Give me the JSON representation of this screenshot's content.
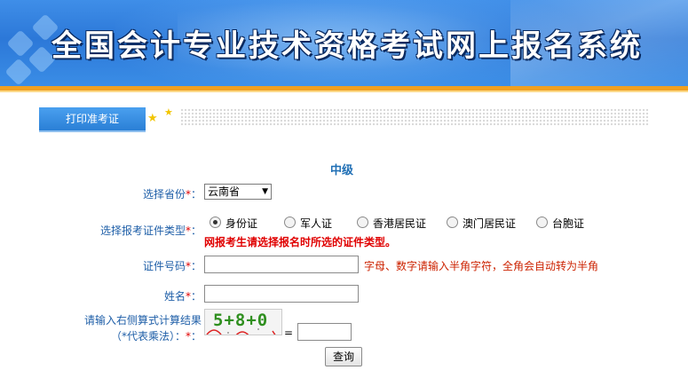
{
  "banner": {
    "title": "全国会计专业技术资格考试网上报名系统"
  },
  "tab": {
    "label": "打印准考证"
  },
  "form": {
    "level": "中级",
    "required_mark": "*",
    "province": {
      "label": "选择省份",
      "value": "云南省"
    },
    "id_type": {
      "label": "选择报考证件类型",
      "options": [
        "身份证",
        "军人证",
        "香港居民证",
        "澳门居民证",
        "台胞证"
      ],
      "selected": "身份证",
      "warning": "网报考生请选择报名时所选的证件类型。"
    },
    "id_number": {
      "label": "证件号码",
      "value": "",
      "hint": "字母、数字请输入半角字符，全角会自动转为半角"
    },
    "name": {
      "label": "姓名",
      "value": ""
    },
    "captcha": {
      "label_line1": "请输入右侧算式计算结果",
      "label_line2": "（*代表乘法）：",
      "expression": "5+8+0",
      "equals": "=",
      "value": ""
    },
    "submit_label": "查询"
  },
  "colors": {
    "banner_blue": "#2c78d8",
    "accent_orange": "#f0a020",
    "label_blue": "#1f5fa8",
    "required_red": "#e00000",
    "captcha_green": "#2f8f1f"
  },
  "icons": [
    "star-icon",
    "star-icon",
    "radio-icon",
    "select-arrow-icon"
  ]
}
